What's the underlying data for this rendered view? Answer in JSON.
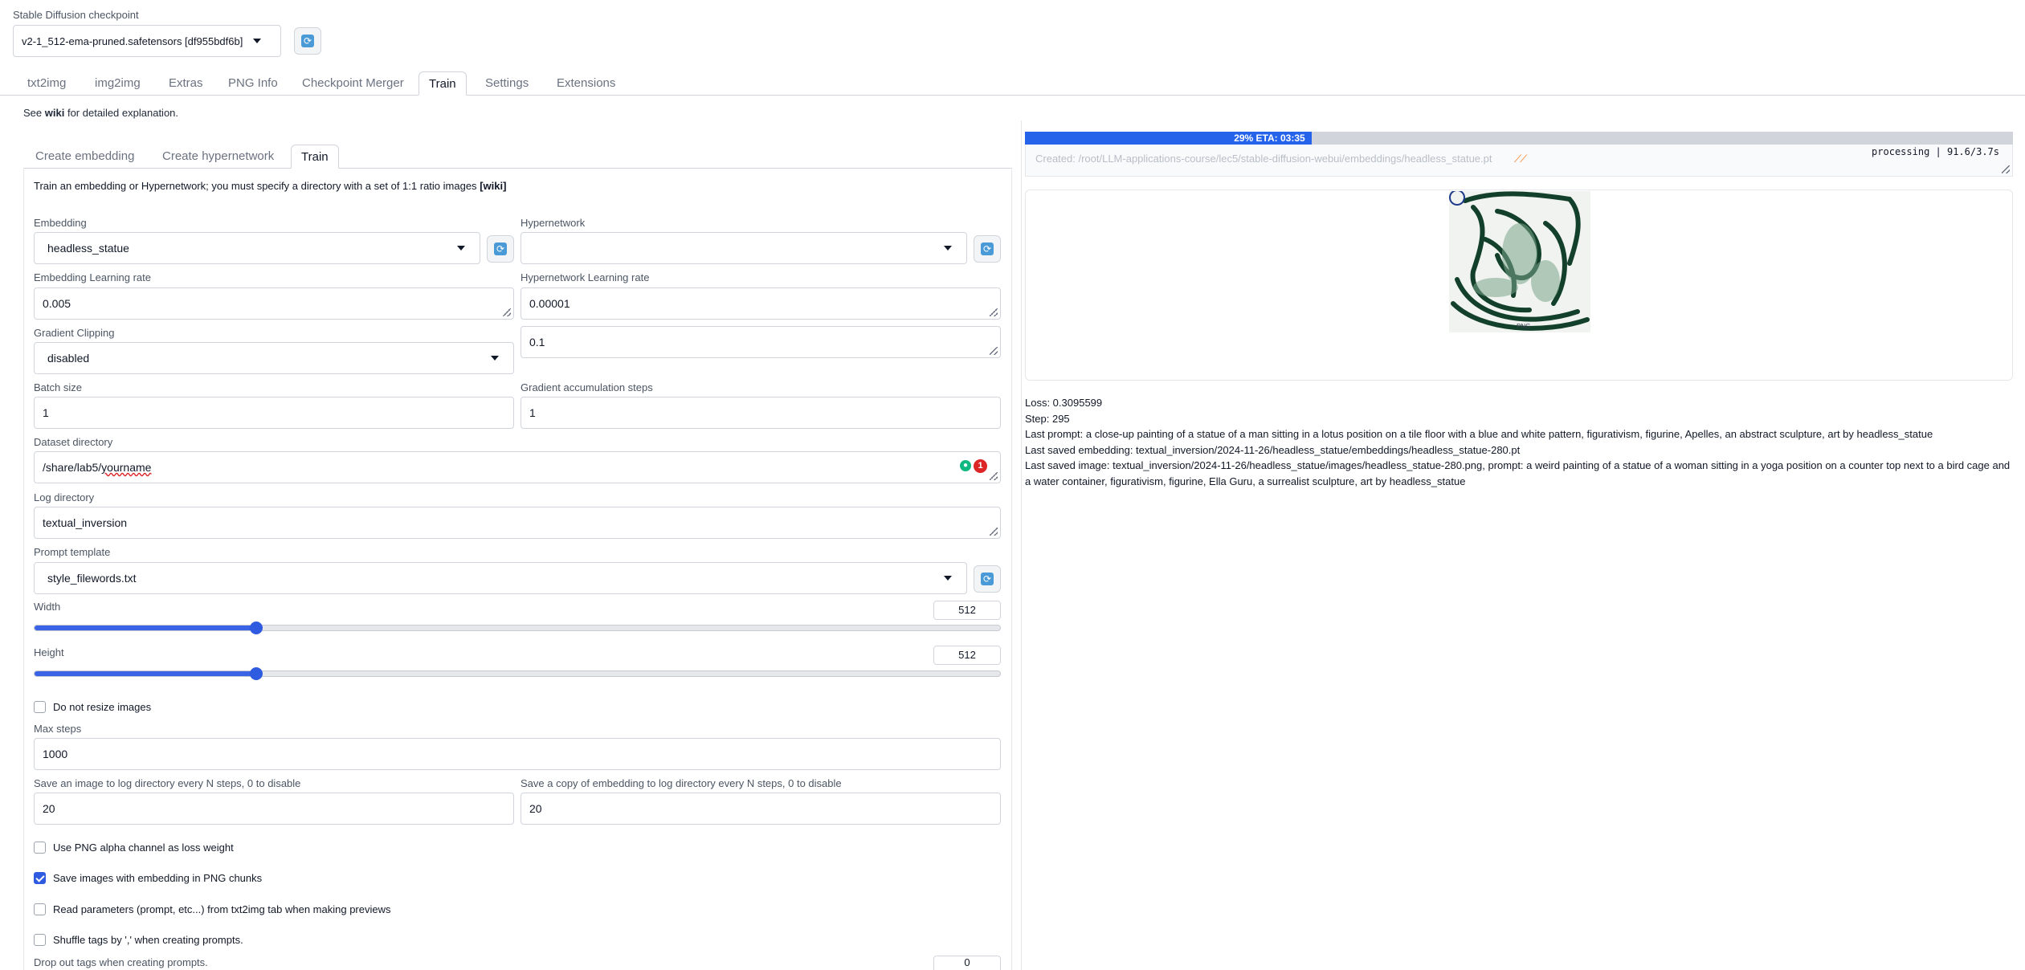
{
  "checkpoint": {
    "label": "Stable Diffusion checkpoint",
    "value": "v2-1_512-ema-pruned.safetensors [df955bdf6b]"
  },
  "main_tabs": [
    {
      "label": "txt2img"
    },
    {
      "label": "img2img"
    },
    {
      "label": "Extras"
    },
    {
      "label": "PNG Info"
    },
    {
      "label": "Checkpoint Merger"
    },
    {
      "label": "Train"
    },
    {
      "label": "Settings"
    },
    {
      "label": "Extensions"
    }
  ],
  "see_wiki": {
    "prefix": "See",
    "link": "wiki",
    "suffix": "for detailed explanation."
  },
  "sub_tabs": [
    {
      "label": "Create embedding"
    },
    {
      "label": "Create hypernetwork"
    },
    {
      "label": "Train"
    }
  ],
  "train": {
    "description": "Train an embedding or Hypernetwork; you must specify a directory with a set of 1:1 ratio images",
    "description_link": "[wiki]",
    "embedding_label": "Embedding",
    "embedding_value": "headless_statue",
    "hypernetwork_label": "Hypernetwork",
    "hypernetwork_value": "",
    "emb_lr_label": "Embedding Learning rate",
    "emb_lr_value": "0.005",
    "hyper_lr_label": "Hypernetwork Learning rate",
    "hyper_lr_value": "0.00001",
    "grad_clip_label": "Gradient Clipping",
    "grad_clip_value": "disabled",
    "grad_clip_amount": "0.1",
    "batch_label": "Batch size",
    "batch_value": "1",
    "grad_acc_label": "Gradient accumulation steps",
    "grad_acc_value": "1",
    "dataset_label": "Dataset directory",
    "dataset_value_a": "/share/lab5/",
    "dataset_value_b": "yourname",
    "dataset_badge": "1",
    "logdir_label": "Log directory",
    "logdir_value": "textual_inversion",
    "prompt_tpl_label": "Prompt template",
    "prompt_tpl_value": "style_filewords.txt",
    "width_label": "Width",
    "width_value": "512",
    "width_fraction": 0.23,
    "height_label": "Height",
    "height_value": "512",
    "height_fraction": 0.23,
    "no_resize_label": "Do not resize images",
    "no_resize_checked": false,
    "max_steps_label": "Max steps",
    "max_steps_value": "1000",
    "save_img_label": "Save an image to log directory every N steps, 0 to disable",
    "save_img_value": "20",
    "save_emb_label": "Save a copy of embedding to log directory every N steps, 0 to disable",
    "save_emb_value": "20",
    "png_alpha_label": "Use PNG alpha channel as loss weight",
    "png_alpha_checked": false,
    "save_png_label": "Save images with embedding in PNG chunks",
    "save_png_checked": true,
    "read_params_label": "Read parameters (prompt, etc...) from txt2img tab when making previews",
    "read_params_checked": false,
    "shuffle_label": "Shuffle tags by ',' when creating prompts.",
    "shuffle_checked": false,
    "dropout_label": "Drop out tags when creating prompts.",
    "dropout_value": "0"
  },
  "output": {
    "progress_text": "29% ETA: 03:35",
    "progress_fraction": 0.29,
    "created_text": "Created: /root/LLM-applications-course/lec5/stable-diffusion-webui/embeddings/headless_statue.pt",
    "status_text": "processing | 91.6/3.7s",
    "image_caption": "PNG",
    "loss": "Loss: 0.3095599",
    "step": "Step: 295",
    "last_prompt": "Last prompt: a close-up painting of a statue of a man sitting in a lotus position on a tile floor with a blue and white pattern, figurativism, figurine, Apelles, an abstract sculpture, art by headless_statue",
    "last_embedding": "Last saved embedding: textual_inversion/2024-11-26/headless_statue/embeddings/headless_statue-280.pt",
    "last_image": "Last saved image: textual_inversion/2024-11-26/headless_statue/images/headless_statue-280.png, prompt: a weird painting of a statue of a woman sitting in a yoga position on a counter top next to a bird cage and a water container, figurativism, figurine, Ella Guru, a surrealist sculpture, art by headless_statue"
  },
  "colors": {
    "accent": "#2f5be0",
    "progress": "#2563eb",
    "refresh_icon": "#4a9ad8",
    "warning": "#dc2626"
  },
  "icons": [
    "refresh-icon",
    "chevron-down-icon",
    "checkbox-icon",
    "grammar-bulb-icon",
    "clipboard-icon"
  ]
}
